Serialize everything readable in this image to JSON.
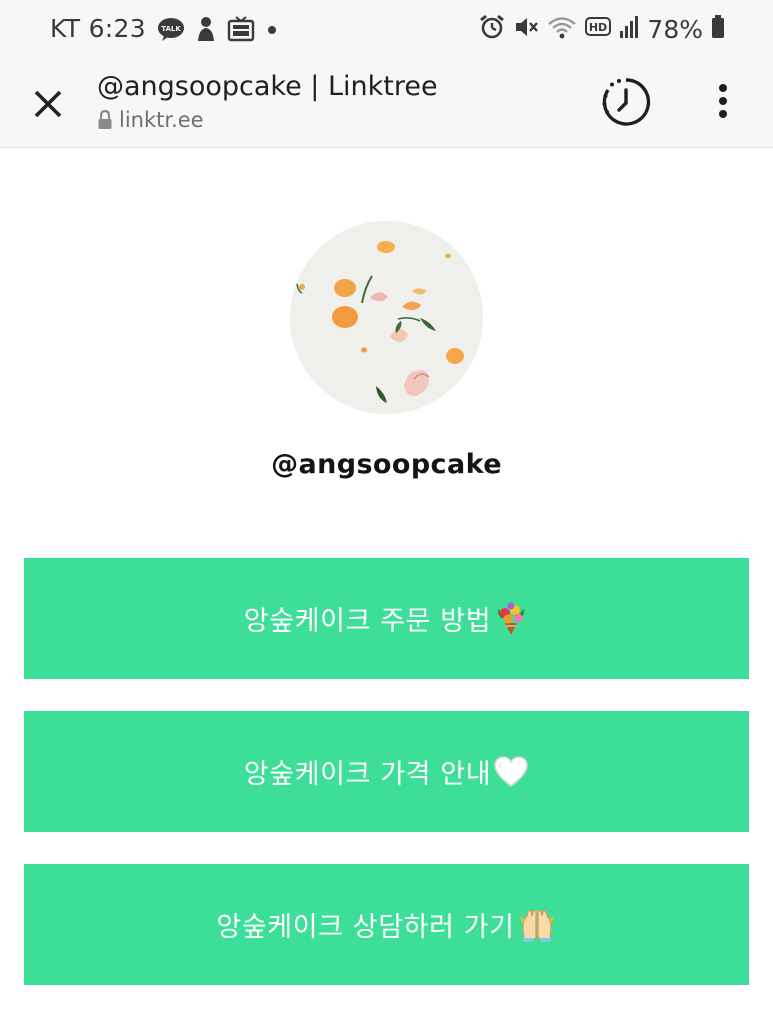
{
  "status_bar": {
    "carrier_time": "KT 6:23",
    "battery": "78%",
    "left_icons": [
      "kakaotalk-icon",
      "person-icon",
      "tv-app-icon",
      "dot-icon"
    ],
    "right_icons": [
      "alarm-icon",
      "mute-icon",
      "wifi-icon",
      "hd-icon",
      "signal-icon",
      "battery-icon"
    ]
  },
  "browser": {
    "title": "@angsoopcake | Linktree",
    "url": "linktr.ee"
  },
  "profile": {
    "handle": "@angsoopcake"
  },
  "links": [
    {
      "label": "앙숲케이크 주문 방법",
      "emoji": "bouquet-icon"
    },
    {
      "label": "앙숲케이크 가격 안내",
      "emoji": "white-heart-icon"
    },
    {
      "label": "앙숲케이크 상담하러 가기",
      "emoji": "raised-hands-icon"
    }
  ],
  "colors": {
    "button_bg": "#3ddf98",
    "button_text": "#ffffff",
    "header_bg": "#f7f7f7"
  }
}
